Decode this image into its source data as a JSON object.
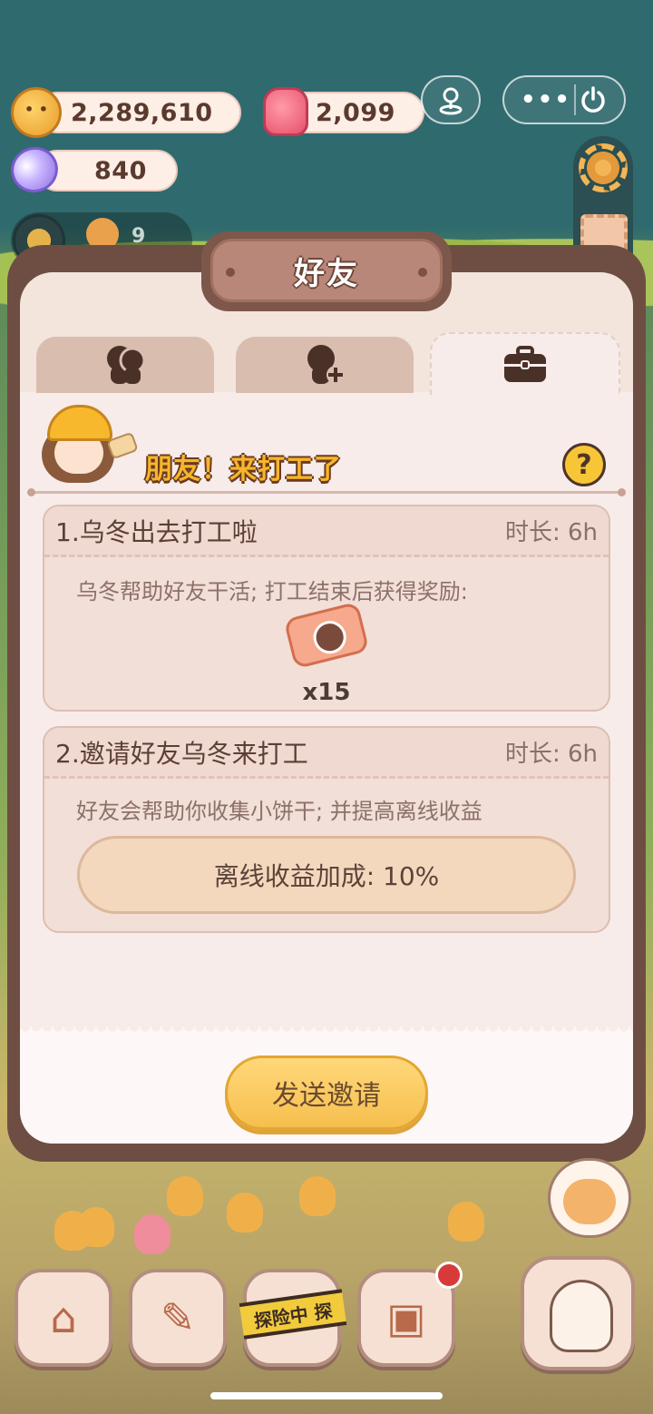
{
  "hud": {
    "cookies": "2,289,610",
    "candy": "2,099",
    "gems": "840",
    "mini_count": "9"
  },
  "dialog": {
    "title": "好友",
    "banner": "朋友！来打工了",
    "help": "?"
  },
  "tabs": [
    {
      "name": "friends",
      "icon": "friends-icon",
      "active": false
    },
    {
      "name": "add-friend",
      "icon": "add-friend-icon",
      "active": false
    },
    {
      "name": "work",
      "icon": "briefcase-icon",
      "active": true
    }
  ],
  "cards": [
    {
      "title": "1.乌冬出去打工啦",
      "duration": "时长: 6h",
      "desc": "乌冬帮助好友干活; 打工结束后获得奖励:",
      "reward_qty": "x15"
    },
    {
      "title": "2.邀请好友乌冬来打工",
      "duration": "时长: 6h",
      "desc": "好友会帮助你收集小饼干; 并提高离线收益",
      "bonus": "离线收益加成: 10%"
    }
  ],
  "send_button": "发送邀请",
  "nav": {
    "explore": "探险中 探"
  },
  "colors": {
    "accent": "#f6bf4e",
    "panel_frame": "#6e4e43",
    "title_plate": "#b9877a"
  }
}
